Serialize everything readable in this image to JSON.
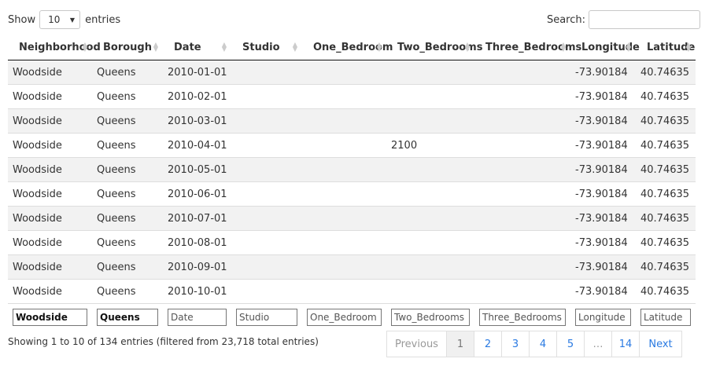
{
  "length": {
    "show": "Show",
    "value": "10",
    "entries": "entries"
  },
  "search": {
    "label": "Search:",
    "value": ""
  },
  "columns": [
    "Neighborhood",
    "Borough",
    "Date",
    "Studio",
    "One_Bedroom",
    "Two_Bedrooms",
    "Three_Bedrooms",
    "Longitude",
    "Latitude"
  ],
  "rows": [
    [
      "Woodside",
      "Queens",
      "2010-01-01",
      "",
      "",
      "",
      "",
      "-73.90184",
      "40.74635"
    ],
    [
      "Woodside",
      "Queens",
      "2010-02-01",
      "",
      "",
      "",
      "",
      "-73.90184",
      "40.74635"
    ],
    [
      "Woodside",
      "Queens",
      "2010-03-01",
      "",
      "",
      "",
      "",
      "-73.90184",
      "40.74635"
    ],
    [
      "Woodside",
      "Queens",
      "2010-04-01",
      "",
      "",
      "2100",
      "",
      "-73.90184",
      "40.74635"
    ],
    [
      "Woodside",
      "Queens",
      "2010-05-01",
      "",
      "",
      "",
      "",
      "-73.90184",
      "40.74635"
    ],
    [
      "Woodside",
      "Queens",
      "2010-06-01",
      "",
      "",
      "",
      "",
      "-73.90184",
      "40.74635"
    ],
    [
      "Woodside",
      "Queens",
      "2010-07-01",
      "",
      "",
      "",
      "",
      "-73.90184",
      "40.74635"
    ],
    [
      "Woodside",
      "Queens",
      "2010-08-01",
      "",
      "",
      "",
      "",
      "-73.90184",
      "40.74635"
    ],
    [
      "Woodside",
      "Queens",
      "2010-09-01",
      "",
      "",
      "",
      "",
      "-73.90184",
      "40.74635"
    ],
    [
      "Woodside",
      "Queens",
      "2010-10-01",
      "",
      "",
      "",
      "",
      "-73.90184",
      "40.74635"
    ]
  ],
  "filters": [
    {
      "value": "Woodside",
      "placeholder": ""
    },
    {
      "value": "Queens",
      "placeholder": ""
    },
    {
      "value": "",
      "placeholder": "Date"
    },
    {
      "value": "",
      "placeholder": "Studio"
    },
    {
      "value": "",
      "placeholder": "One_Bedroom"
    },
    {
      "value": "",
      "placeholder": "Two_Bedrooms"
    },
    {
      "value": "",
      "placeholder": "Three_Bedrooms"
    },
    {
      "value": "",
      "placeholder": "Longitude"
    },
    {
      "value": "",
      "placeholder": "Latitude"
    }
  ],
  "info": "Showing 1 to 10 of 134 entries (filtered from 23,718 total entries)",
  "pagination": {
    "previous": "Previous",
    "pages": [
      "1",
      "2",
      "3",
      "4",
      "5",
      "…",
      "14"
    ],
    "active": "1",
    "next": "Next"
  },
  "colors": {
    "accent": "#2a7ae2",
    "stripe": "#f2f2f2"
  }
}
